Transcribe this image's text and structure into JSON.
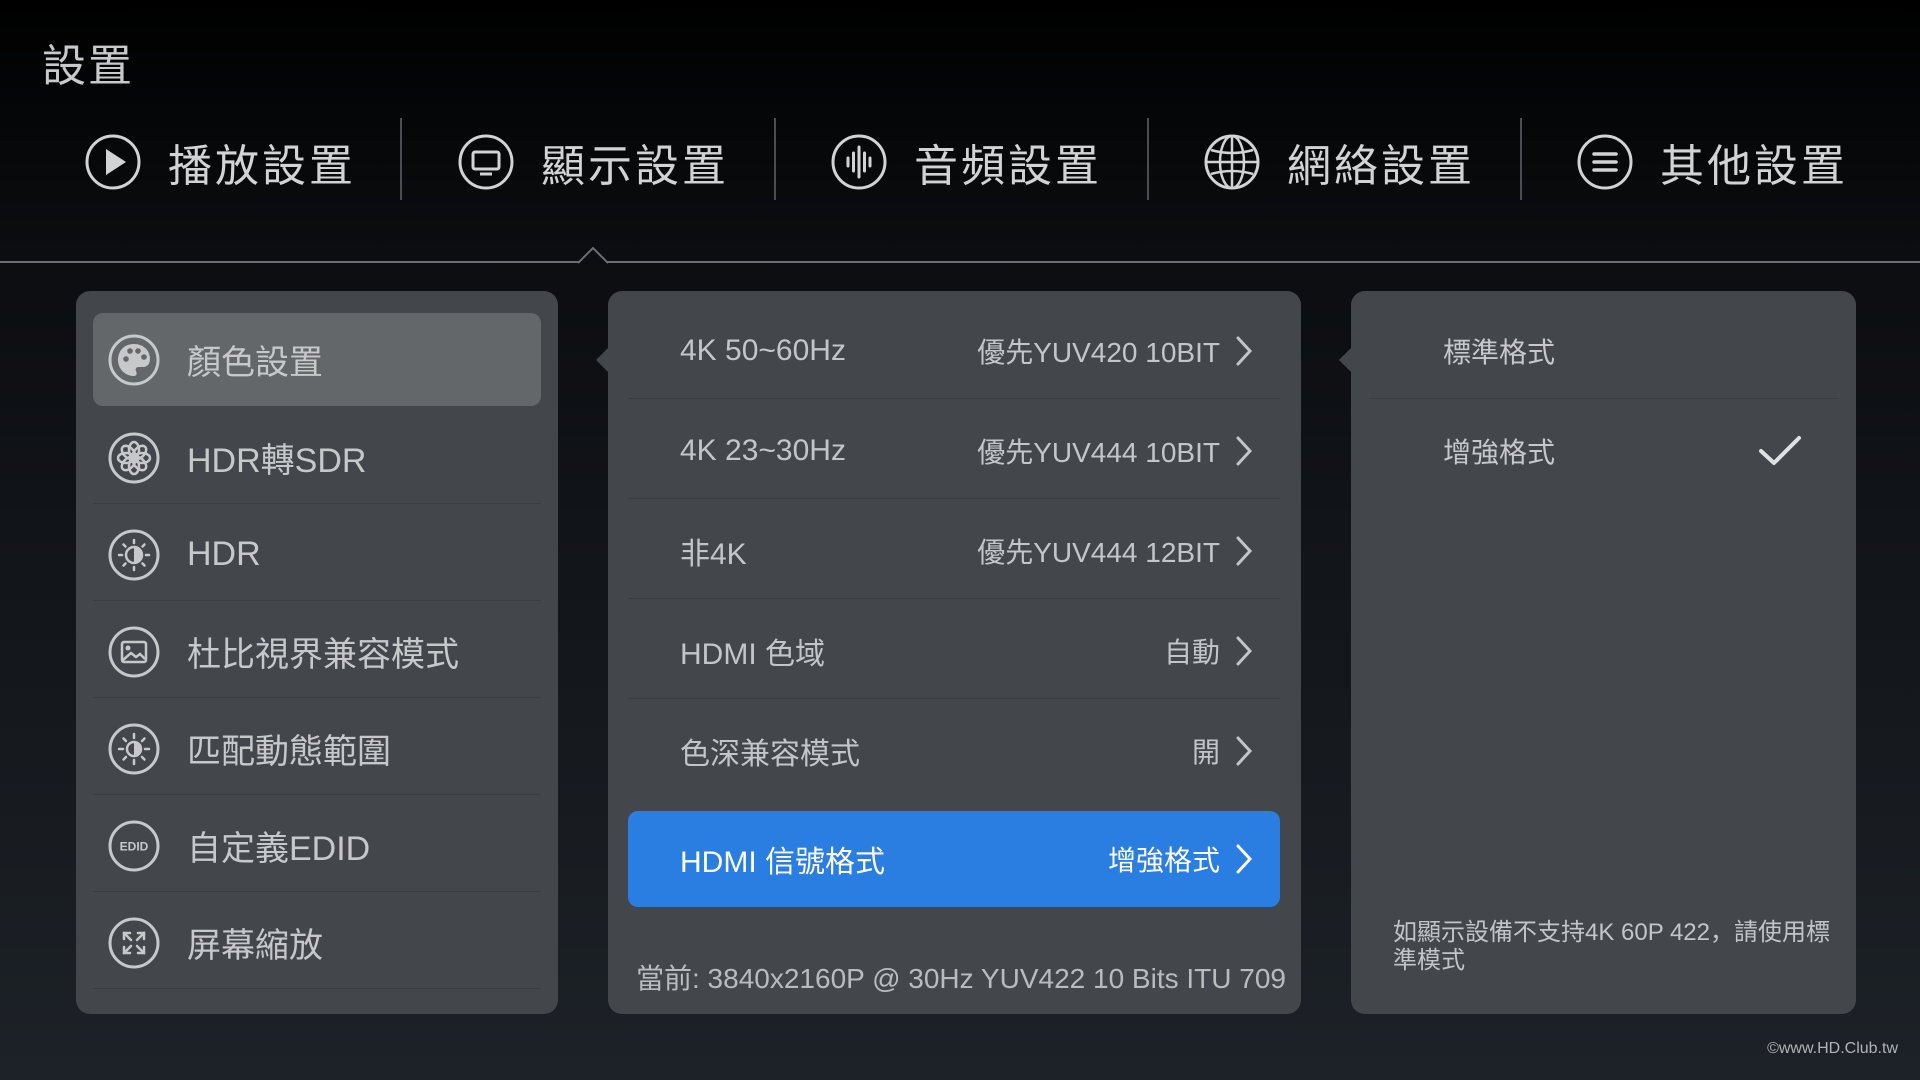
{
  "page_title": "設置",
  "tabs": [
    {
      "label": "播放設置",
      "icon": "play-icon"
    },
    {
      "label": "顯示設置",
      "icon": "monitor-icon"
    },
    {
      "label": "音頻設置",
      "icon": "audio-wave-icon"
    },
    {
      "label": "網絡設置",
      "icon": "globe-icon"
    },
    {
      "label": "其他設置",
      "icon": "menu-lines-icon"
    }
  ],
  "active_tab": "顯示設置",
  "left_menu": [
    {
      "label": "顏色設置",
      "icon": "palette-icon",
      "selected": true
    },
    {
      "label": "HDR轉SDR",
      "icon": "aperture-icon"
    },
    {
      "label": "HDR",
      "icon": "hdr-sun-icon"
    },
    {
      "label": "杜比視界兼容模式",
      "icon": "picture-icon"
    },
    {
      "label": "匹配動態範圍",
      "icon": "brightness-icon"
    },
    {
      "label": "自定義EDID",
      "icon": "edid-icon",
      "icon_text": "EDID"
    },
    {
      "label": "屏幕縮放",
      "icon": "expand-arrows-icon"
    }
  ],
  "middle_menu": [
    {
      "label": "4K 50~60Hz",
      "value": "優先YUV420 10BIT"
    },
    {
      "label": "4K 23~30Hz",
      "value": "優先YUV444 10BIT"
    },
    {
      "label": "非4K",
      "value": "優先YUV444 12BIT"
    },
    {
      "label": "HDMI 色域",
      "value": "自動"
    },
    {
      "label": "色深兼容模式",
      "value": "開"
    },
    {
      "label": "HDMI 信號格式",
      "value": "增強格式",
      "active": true
    }
  ],
  "status_line": "當前: 3840x2160P @ 30Hz  YUV422  10 Bits  ITU 709",
  "right_options": [
    {
      "label": "標準格式",
      "checked": false
    },
    {
      "label": "增強格式",
      "checked": true
    }
  ],
  "right_note": "如顯示設備不支持4K 60P 422，請使用標準模式",
  "watermark": "©www.HD.Club.tw",
  "colors": {
    "accent": "#2a7de1",
    "panel": "#43474c",
    "selected_item": "#636769",
    "text": "#c6c8ca"
  }
}
